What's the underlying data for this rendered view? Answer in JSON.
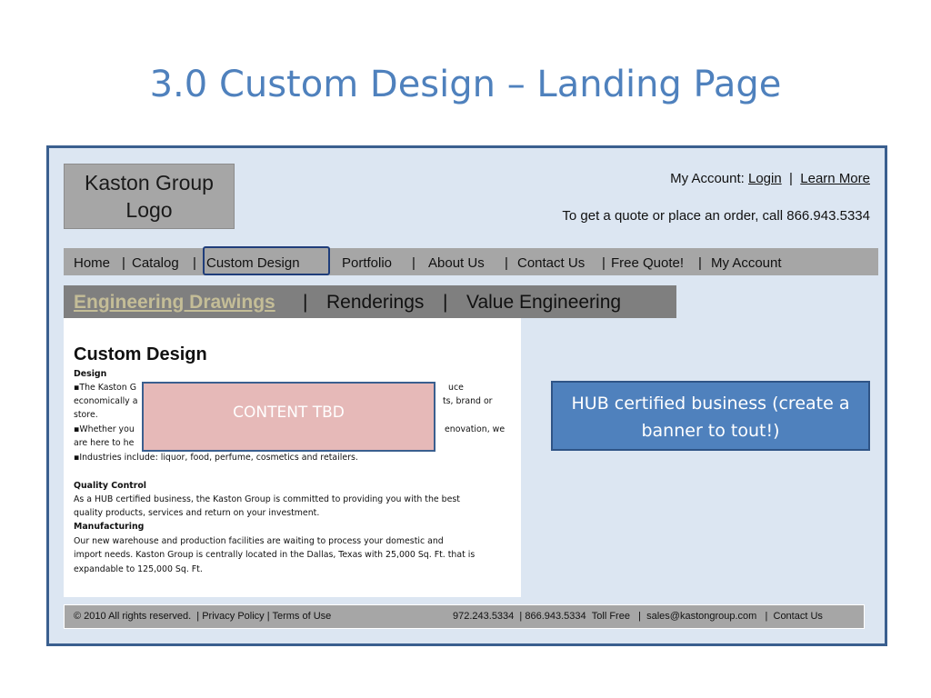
{
  "slide": {
    "title": "3.0 Custom Design – Landing Page"
  },
  "header": {
    "logo_line1": "Kaston Group",
    "logo_line2": "Logo",
    "account_label": "My Account:",
    "login_link": "Login",
    "account_sep": "|",
    "learn_more_link": "Learn More",
    "quote_text": "To get a quote or place an order, call 866.943.5334"
  },
  "top_nav": {
    "home": "Home",
    "catalog": "Catalog",
    "custom_design": "Custom Design",
    "portfolio": "Portfolio",
    "about_us": "About Us",
    "contact_us": "Contact Us",
    "free_quote": "Free Quote!",
    "my_account": "My Account",
    "sep": "|"
  },
  "sub_nav": {
    "engineering_drawings": "Engineering Drawings",
    "renderings": "Renderings",
    "value_engineering": "Value Engineering",
    "sep": "|"
  },
  "content": {
    "heading": "Custom Design",
    "design_label": "Design",
    "bullet1_start": "▪The Kaston G",
    "bullet1_end": "uce",
    "bullet1_line2_start": "economically a",
    "bullet1_line2_end": "ts, brand or",
    "bullet1_line3": "store.",
    "bullet2_start": "▪Whether you",
    "bullet2_end": "enovation, we",
    "bullet2_line2": "are here to he",
    "bullet3": "▪Industries include: liquor, food, perfume, cosmetics and retailers.",
    "quality_label": "Quality Control",
    "quality_line1": "As a HUB certified business, the Kaston Group is committed to providing you with the best",
    "quality_line2": "quality products, services and return on your investment.",
    "manufacturing_label": "Manufacturing",
    "manufacturing_line1": "Our new warehouse and production facilities are waiting to process your domestic and",
    "manufacturing_line2": "import needs. Kaston Group is centrally located in the Dallas, Texas with 25,000 Sq. Ft. that is",
    "manufacturing_line3": "expandable to 125,000 Sq. Ft.",
    "tbd_label": "CONTENT TBD"
  },
  "banner": {
    "hub_text": "HUB certified business (create a banner to tout!)"
  },
  "footer": {
    "copyright": "© 2010 All rights reserved.",
    "privacy": "Privacy Policy",
    "terms": "Terms of Use",
    "phone1": "972.243.5334",
    "phone2": "866.943.5334",
    "toll_free": "Toll Free",
    "email": "sales@kastongroup.com",
    "contact": "Contact Us",
    "sep": "|"
  },
  "colors": {
    "title_blue": "#4f81bd",
    "frame_bg": "#dce6f2",
    "nav_gray": "#a6a6a6",
    "subnav_gray": "#7f7f7f",
    "active_tan": "#c4bd97",
    "tbd_pink": "#e6b9b8",
    "banner_blue": "#4f81bd"
  }
}
